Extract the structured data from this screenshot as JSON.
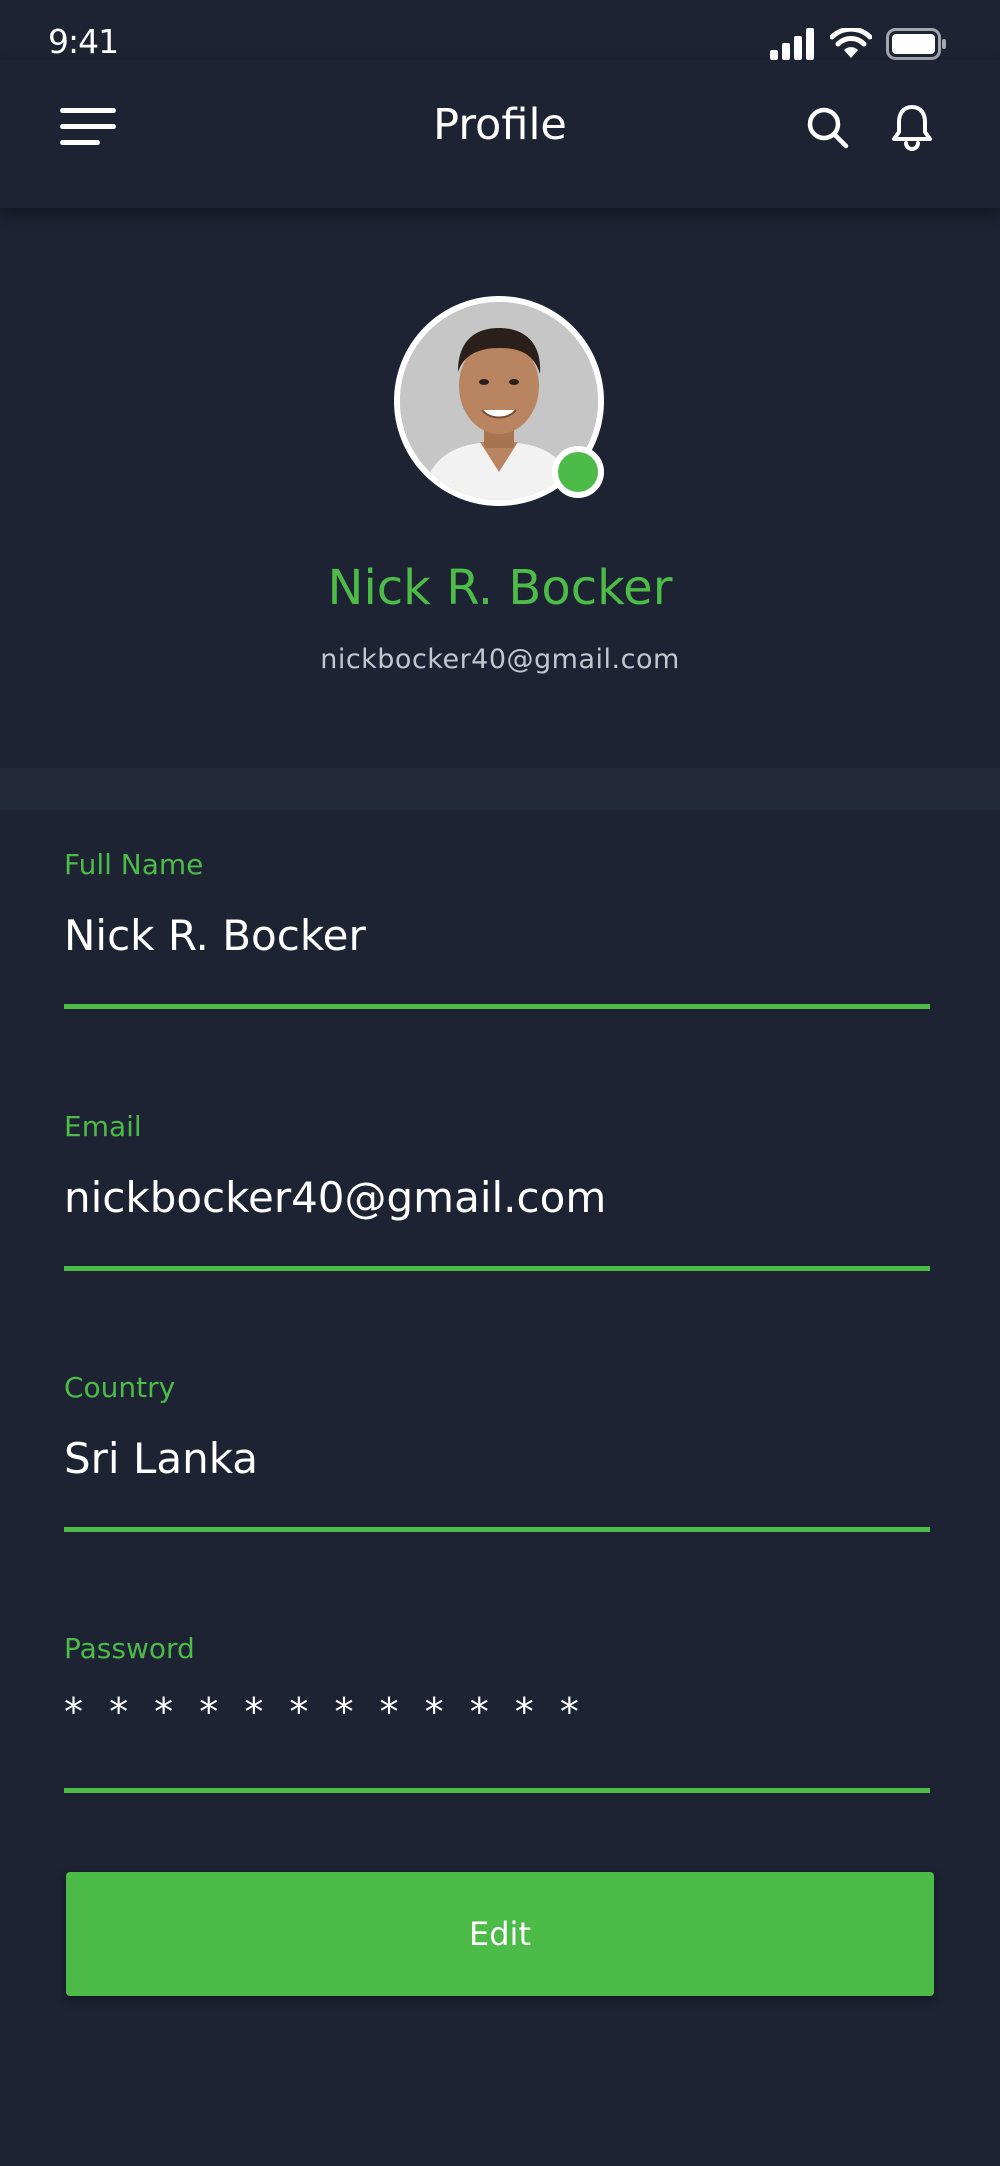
{
  "status_bar": {
    "time": "9:41"
  },
  "header": {
    "title": "Profile"
  },
  "profile": {
    "name": "Nick R. Bocker",
    "email": "nickbocker40@gmail.com",
    "online": true
  },
  "form": {
    "full_name": {
      "label": "Full Name",
      "value": "Nick R. Bocker"
    },
    "email": {
      "label": "Email",
      "value": "nickbocker40@gmail.com"
    },
    "country": {
      "label": "Country",
      "value": "Sri Lanka"
    },
    "password": {
      "label": "Password",
      "value": "* * * * * * * * * * * *"
    }
  },
  "actions": {
    "edit_label": "Edit"
  },
  "colors": {
    "background": "#1d2333",
    "accent": "#4cbb47",
    "band": "#222a3a"
  }
}
